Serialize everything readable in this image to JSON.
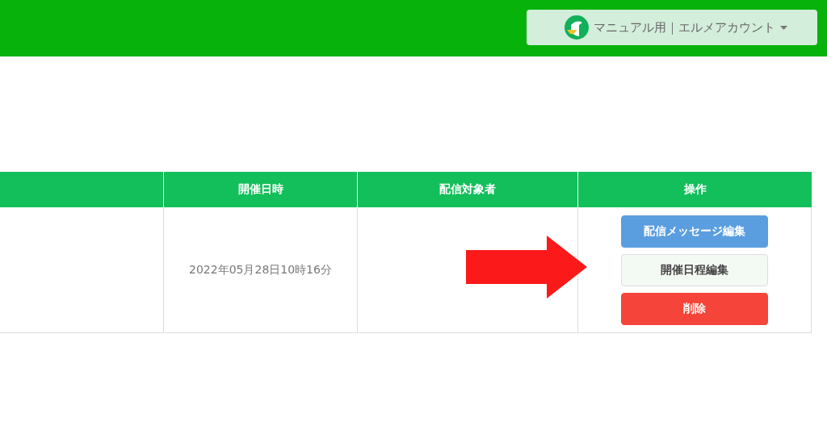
{
  "header": {
    "account": {
      "label": "マニュアル用｜エルメアカウント"
    }
  },
  "table": {
    "columns": [
      "開催日時",
      "配信対象者",
      "操作"
    ],
    "rows": [
      {
        "date": "2022年05月28日10時16分",
        "actions": [
          {
            "label": "配信メッセージ編集",
            "kind": "primary"
          },
          {
            "label": "開催日程編集",
            "kind": "default"
          },
          {
            "label": "削除",
            "kind": "danger"
          }
        ]
      }
    ]
  }
}
